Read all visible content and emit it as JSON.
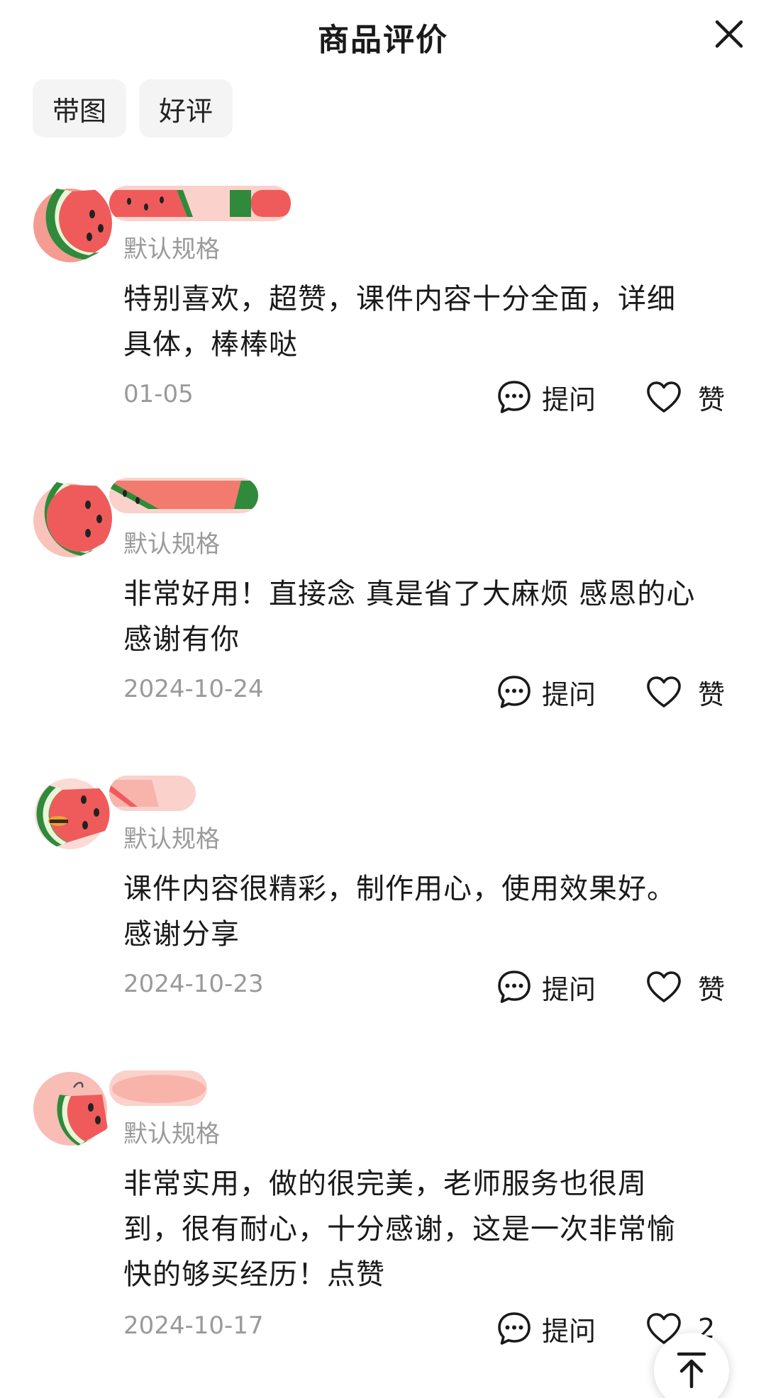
{
  "header": {
    "title": "商品评价"
  },
  "filters": [
    {
      "label": "带图"
    },
    {
      "label": "好评"
    }
  ],
  "reviews": [
    {
      "spec": "默认规格",
      "lines": [
        "特别喜欢，超赞，课件内容十分全面，详细",
        "具体，棒棒哒"
      ],
      "date": "01-05",
      "ask_label": "提问",
      "like_label": "赞"
    },
    {
      "spec": "默认规格",
      "lines": [
        "非常好用！直接念 真是省了大麻烦 感恩的心",
        "感谢有你"
      ],
      "date": "2024-10-24",
      "ask_label": "提问",
      "like_label": "赞"
    },
    {
      "spec": "默认规格",
      "lines": [
        "课件内容很精彩，制作用心，使用效果好。",
        "感谢分享"
      ],
      "date": "2024-10-23",
      "ask_label": "提问",
      "like_label": "赞"
    },
    {
      "spec": "默认规格",
      "lines": [
        "非常实用，做的很完美，老师服务也很周",
        "到，很有耐心，十分感谢，这是一次非常愉",
        "快的够买经历！点赞"
      ],
      "date": "2024-10-17",
      "ask_label": "提问",
      "like_label": "2"
    }
  ],
  "colors": {
    "text": "#1a1a1a",
    "muted": "#9a9a9a",
    "chip_bg": "#f4f4f4",
    "watermelon_red": "#f06a6a",
    "watermelon_green": "#2f8a3c"
  },
  "icons": {
    "close": "close-icon",
    "ask": "chat-bubble-dots-icon",
    "like": "heart-outline-icon",
    "top": "arrow-up-to-top-icon"
  }
}
